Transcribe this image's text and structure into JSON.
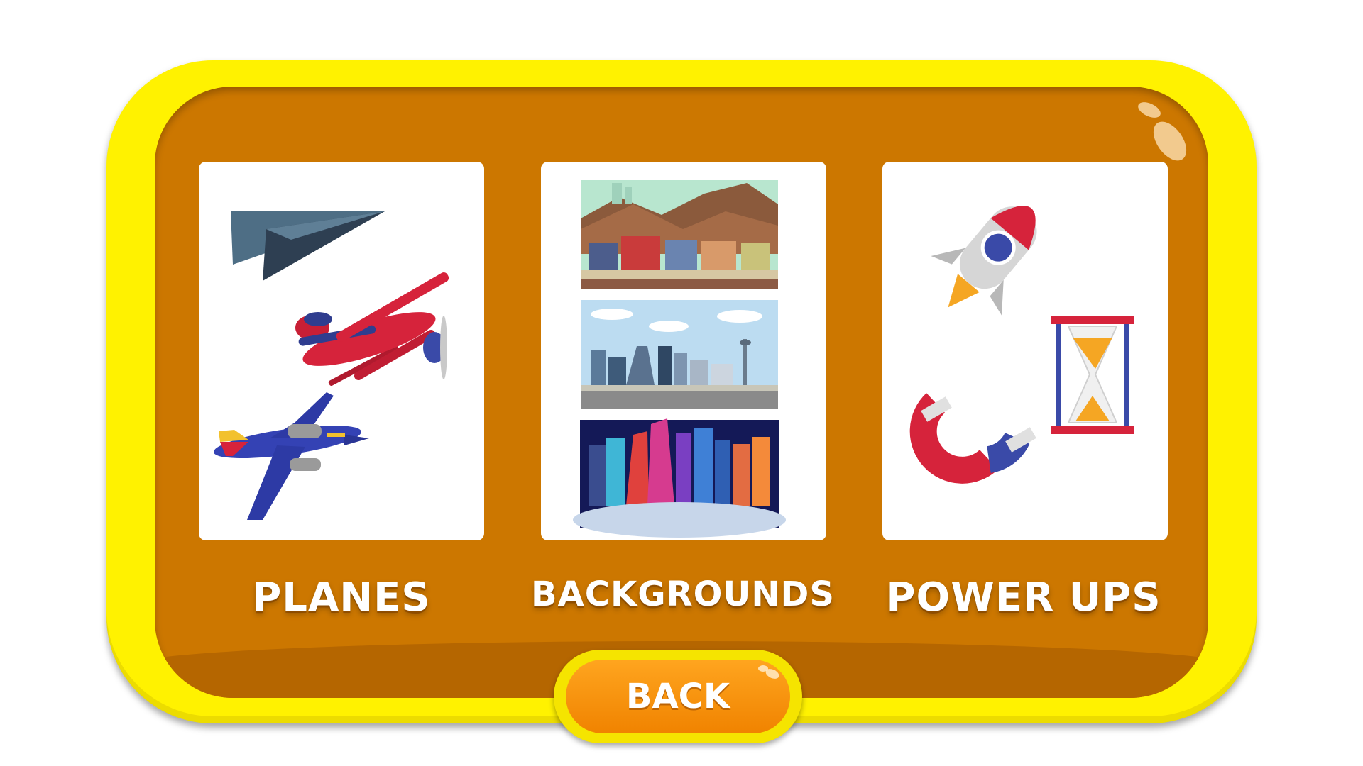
{
  "menu": {
    "categories": [
      {
        "id": "planes",
        "label": "PLANES",
        "icons": [
          "paper-plane-icon",
          "biplane-icon",
          "jet-airliner-icon"
        ]
      },
      {
        "id": "backgrounds",
        "label": "BACKGROUNDS",
        "icons": [
          "town-background-thumb",
          "city-skyline-background-thumb",
          "night-city-background-thumb"
        ]
      },
      {
        "id": "powerups",
        "label": "POWER UPS",
        "icons": [
          "rocket-icon",
          "hourglass-icon",
          "magnet-icon"
        ]
      }
    ],
    "back_label": "BACK"
  },
  "colors": {
    "frame_yellow": "#fff200",
    "panel_orange": "#cc7700",
    "button_orange": "#f59400",
    "card_white": "#ffffff"
  }
}
